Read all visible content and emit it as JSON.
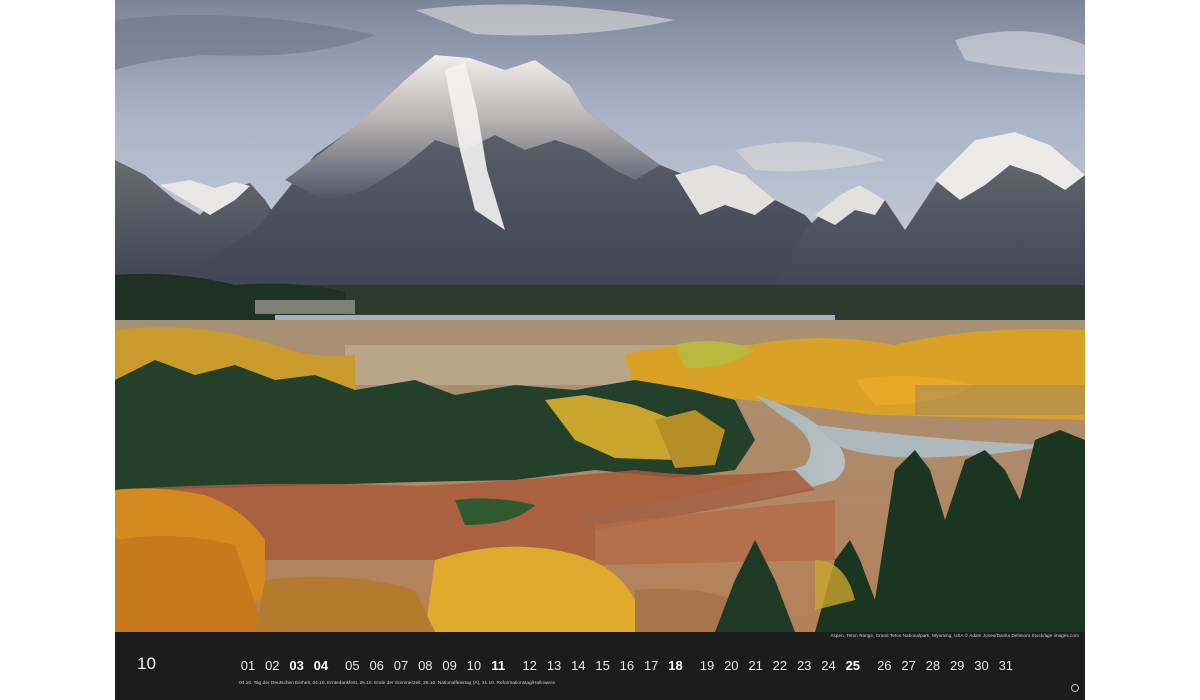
{
  "calendar": {
    "month_number": "10",
    "days": [
      {
        "label": "01",
        "bold": false
      },
      {
        "label": "02",
        "bold": false
      },
      {
        "label": "03",
        "bold": true
      },
      {
        "label": "04",
        "bold": true
      },
      {
        "label": "05",
        "bold": false
      },
      {
        "label": "06",
        "bold": false
      },
      {
        "label": "07",
        "bold": false
      },
      {
        "label": "08",
        "bold": false
      },
      {
        "label": "09",
        "bold": false
      },
      {
        "label": "10",
        "bold": false
      },
      {
        "label": "11",
        "bold": true
      },
      {
        "label": "12",
        "bold": false
      },
      {
        "label": "13",
        "bold": false
      },
      {
        "label": "14",
        "bold": false
      },
      {
        "label": "15",
        "bold": false
      },
      {
        "label": "16",
        "bold": false
      },
      {
        "label": "17",
        "bold": false
      },
      {
        "label": "18",
        "bold": true
      },
      {
        "label": "19",
        "bold": false
      },
      {
        "label": "20",
        "bold": false
      },
      {
        "label": "21",
        "bold": false
      },
      {
        "label": "22",
        "bold": false
      },
      {
        "label": "23",
        "bold": false
      },
      {
        "label": "24",
        "bold": false
      },
      {
        "label": "25",
        "bold": true
      },
      {
        "label": "26",
        "bold": false
      },
      {
        "label": "27",
        "bold": false
      },
      {
        "label": "28",
        "bold": false
      },
      {
        "label": "29",
        "bold": false
      },
      {
        "label": "30",
        "bold": false
      },
      {
        "label": "31",
        "bold": false
      }
    ],
    "holiday_note": "03.10. Tag der Deutschen Einheit, 04.10. Erntedankfest, 25.10. Ende der Sommerzeit, 26.10. Nationalfeiertag (A), 31.10. Reformationstag/Halloween",
    "photo_credit": "Aspen, Teton Range, Grand Teton Nationalpark, Wyoming, USA © Adam Jones/Danita Delimont Stock/age images.com"
  },
  "colors": {
    "strip_background": "#1c1c1c",
    "sky": "#9aa6bc",
    "aspen_gold": "#e0a020",
    "conifer": "#1f3a22"
  }
}
